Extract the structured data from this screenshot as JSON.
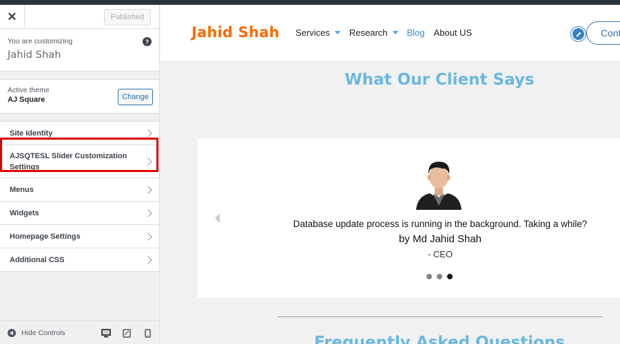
{
  "sidebar": {
    "close_glyph": "✕",
    "published_label": "Published",
    "customizing_label": "You are customizing",
    "site_name": "Jahid Shah",
    "help_glyph": "?",
    "active_theme_label": "Active theme",
    "theme_name": "AJ Square",
    "change_label": "Change",
    "items": [
      {
        "label": "Site Identity"
      },
      {
        "label": "AJSQTESL Slider Customization Settings",
        "highlighted": true
      },
      {
        "label": "Menus"
      },
      {
        "label": "Widgets"
      },
      {
        "label": "Homepage Settings"
      },
      {
        "label": "Additional CSS"
      }
    ],
    "hide_controls_label": "Hide Controls",
    "devices": [
      "desktop-icon",
      "tablet-icon",
      "mobile-icon"
    ]
  },
  "annotation": {
    "highlight_color": "#e10000",
    "arrow": "right-arrow"
  },
  "preview": {
    "logo": "Jahid Shah",
    "nav": [
      {
        "label": "Services",
        "dropdown": true
      },
      {
        "label": "Research",
        "dropdown": true
      },
      {
        "label": "Blog",
        "active": true
      },
      {
        "label": "About US"
      }
    ],
    "cta_label": "Cont",
    "section_title": "What Our Client Says",
    "testimonial": {
      "quote": "Database update process is running in the background. Taking a while?",
      "author": "by Md Jahid Shah",
      "role": "- CEO",
      "dots_total": 3,
      "dot_active_index": 2
    },
    "next_section_title": "Frequently Asked Questions"
  },
  "colors": {
    "logo": "#ff6a00",
    "section_title": "#6bb7e0",
    "accent_blue": "#2271b1"
  }
}
